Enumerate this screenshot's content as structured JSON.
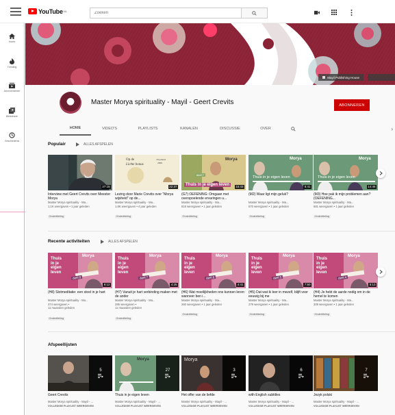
{
  "header": {
    "logo_text": "YouTube",
    "logo_sup": "NL",
    "search_placeholder": "Zoeken"
  },
  "sidebar": {
    "items": [
      {
        "label": "Home",
        "icon": "home-icon"
      },
      {
        "label": "Trending",
        "icon": "flame-icon"
      },
      {
        "label": "Abonnementen",
        "icon": "subscriptions-icon"
      },
      {
        "label": "Bibliotheek",
        "icon": "library-icon"
      },
      {
        "label": "Geschiedenis",
        "icon": "history-icon"
      }
    ]
  },
  "banner": {
    "link_label": "Mayil Publishing House"
  },
  "channel": {
    "title": "Master Morya spirituality - Mayil - Geert Crevits",
    "subscribe_label": "ABONNEREN",
    "tabs": [
      "HOME",
      "VIDEO'S",
      "PLAYLISTS",
      "KANALEN",
      "DISCUSSIE",
      "OVER"
    ]
  },
  "sections": {
    "popular": {
      "title": "Populair",
      "play_all": "ALLES AFSPELEN",
      "videos": [
        {
          "title": "Interview met Geert Crevits over Meester Morya",
          "channel": "Master Morya spirituality - Ma...",
          "meta": "1,1K weergaven • 1 jaar geleden",
          "badge": "Ondertiteling",
          "duration": "37:15"
        },
        {
          "title": "Lezing door Marie Crevits over \"Morya wijsheid\" op de...",
          "channel": "Master Morya spirituality - Ma...",
          "meta": "1,8K weergaven • 4 jaar geleden",
          "badge": "Ondertiteling",
          "duration": "22:37"
        },
        {
          "title": "(G7) OEFENING: Omgaan met overspoelende ervaringen u...",
          "channel": "Master Morya spirituality - Ma...",
          "meta": "816 weergaven • 1 jaar geleden",
          "badge": "Ondertiteling",
          "duration": "15:43"
        },
        {
          "title": "(M2) Waar ligt mijn geluk?",
          "channel": "Master Morya spirituality - Ma...",
          "meta": "570 weergaven • 1 jaar geleden",
          "badge": "Ondertiteling",
          "duration": "5:41"
        },
        {
          "title": "(M3) Hoe pak ik mijn problemen aan? (OEFENING...",
          "channel": "Master Morya spirituality - Ma...",
          "meta": "681 weergaven • 1 jaar geleden",
          "badge": "Ondertiteling",
          "duration": "14:46"
        }
      ]
    },
    "recent": {
      "title": "Recente activiteiten",
      "play_all": "ALLES AFSPELEN",
      "videos": [
        {
          "title": "(H8) Slotmeditatie: een stoel in je hart",
          "channel": "Master Morya spirituality - Ma...",
          "meta": "374 weergaven •",
          "meta2": "11 maanden geleden",
          "badge": "Ondertiteling",
          "duration": "9:12",
          "deel": "deel 8"
        },
        {
          "title": "(H7) Vanuit je hart verbinding maken met de ander",
          "channel": "Master Morya spirituality - Ma...",
          "meta": "285 weergaven •",
          "meta2": "11 maanden geleden",
          "badge": "Ondertiteling",
          "duration": "4:25",
          "deel": "deel 7"
        },
        {
          "title": "(H6) Wat moeilijkheden ons kunnen leren: wanneer ben i...",
          "channel": "Master Morya spirituality - Ma...",
          "meta": "260 weergaven • 1 jaar geleden",
          "meta2": "",
          "badge": "Ondertiteling",
          "duration": "4:41",
          "deel": "deel 6"
        },
        {
          "title": "(H5) Dat wat ik leer in mezelf, blijft voor eeuwig bij me",
          "channel": "Master Morya spirituality - Ma...",
          "meta": "279 weergaven • 1 jaar geleden",
          "meta2": "",
          "badge": "Ondertiteling",
          "duration": "7:50",
          "deel": "deel 5"
        },
        {
          "title": "(H4) Je hebt de aarde nodig om in de hemel te komen",
          "channel": "Master Morya spirituality - Ma...",
          "meta": "309 weergaven • 1 jaar geleden",
          "meta2": "",
          "badge": "Ondertiteling",
          "duration": "5:13",
          "deel": "deel 4"
        }
      ],
      "thumb_heading": "Morya",
      "thumb_text": [
        "Thuis",
        "in je",
        "eigen",
        "leven"
      ]
    },
    "playlists": {
      "title": "Afspeellijsten",
      "items": [
        {
          "title": "Geert Crevits",
          "channel": "Master Morya spirituality - Mayil - ...",
          "link": "VOLLEDIGE PLAYLIST WEERGEVEN",
          "count": "5"
        },
        {
          "title": "Thuis in je eigen leven",
          "channel": "Master Morya spirituality - Mayil - ...",
          "link": "VOLLEDIGE PLAYLIST WEERGEVEN",
          "count": "27"
        },
        {
          "title": "Het offer van de liefde",
          "channel": "Master Morya spirituality - Mayil - ...",
          "link": "VOLLEDIGE PLAYLIST WEERGEVEN",
          "count": "3"
        },
        {
          "title": "with English subtitles",
          "channel": "Master Morya spirituality - Mayil - ...",
          "link": "VOLLEDIGE PLAYLIST WEERGEVEN",
          "count": "6"
        },
        {
          "title": "Jezyk polski",
          "channel": "Master Morya spirituality - Mayil - ...",
          "link": "VOLLEDIGE PLAYLIST WEERGEVEN",
          "count": "7"
        }
      ]
    }
  },
  "thumb_overlays": {
    "p2_line1": "Op de",
    "p2_line2": "Lichte bonus",
    "p2_line3": "18 januari",
    "p2_line4": "2009",
    "p3_line": "Thuis in je eigen leven",
    "p3_deel": "deel 7",
    "p3_morya": "Morya",
    "p4_line": "Thuis in je eigen leven",
    "p4_morya": "Morya",
    "pl2_morya": "Morya",
    "pl3_morya": "Morya"
  },
  "colors": {
    "brand_red": "#ff0000",
    "subscribe_red": "#cc0000",
    "banner_bg": "#8a2336"
  }
}
